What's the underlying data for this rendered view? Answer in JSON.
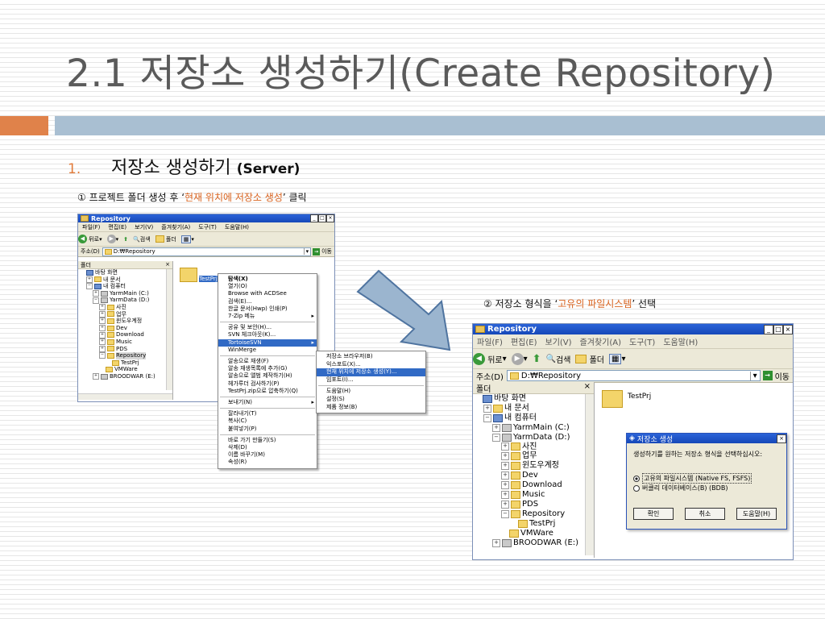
{
  "slide": {
    "title": "2.1 저장소 생성하기(Create Repository)",
    "bullet_number": "1.",
    "bullet_text": "저장소 생성하기",
    "bullet_sub": "(Server)",
    "step1_prefix": "① 프로젝트 폴더 생성 후 ‘",
    "step1_highlight": "현재 위치에 저장소 생성",
    "step1_suffix": "’ 클릭",
    "step2_prefix": "② 저장소 형식을 ‘",
    "step2_highlight": "고유의 파일시스템",
    "step2_suffix": "’ 선택",
    "colors": {
      "accent_orange": "#e0824a",
      "band_blue": "#a9bfd2",
      "title_gray": "#5a5a5a",
      "highlight": "#d9631f",
      "xp_title": "#2b63d8"
    }
  },
  "shot1": {
    "window_title": "Repository",
    "menu": [
      "파일(F)",
      "편집(E)",
      "보기(V)",
      "즐겨찾기(A)",
      "도구(T)",
      "도움말(H)"
    ],
    "toolbar": {
      "back": "뒤로",
      "search": "검색",
      "folders": "폴더"
    },
    "address_label": "주소(D)",
    "address_value": "D:₩Repository",
    "go": "이동",
    "folders_header": "폴더",
    "close_glyph": "×",
    "tree": [
      "바탕 화면",
      "내 문서",
      "내 컴퓨터",
      "YarmMain (C:)",
      "YarmData (D:)",
      "사진",
      "업무",
      "윈도우계정",
      "Dev",
      "Download",
      "Music",
      "PDS",
      "Repository",
      "TestPrj",
      "VMWare",
      "BROODWAR (E:)"
    ],
    "item_label": "TestPrj",
    "context_menu": [
      "탐색(X)",
      "열기(O)",
      "Browse with ACDSee",
      "검색(E)...",
      "한글 문서(Hwp) 인쇄(P)",
      "7-Zip 메뉴",
      "공유 및 보안(H)...",
      "SVN 체크아웃(K)...",
      "TortoiseSVN",
      "WinMerge",
      "알송으로 재생(F)",
      "알송 재생목록에 추가(G)",
      "알송으로 앨범 제작하기(H)",
      "헤가루더 검사하기(P)",
      "TestPrj.zip으로 압축하기(Q)",
      "보내기(N)",
      "잘라내기(T)",
      "복사(C)",
      "붙여넣기(P)",
      "바로 가기 만들기(S)",
      "삭제(D)",
      "이름 바꾸기(M)",
      "속성(R)"
    ],
    "submenu": [
      "저장소 브라우저(B)",
      "익스포트(X)...",
      "현재 위치에 저장소 생성(Y)...",
      "임포트(I)...",
      "도움말(H)",
      "설정(S)",
      "제품 정보(B)"
    ]
  },
  "shot2": {
    "window_title": "Repository",
    "menu": [
      "파일(F)",
      "편집(E)",
      "보기(V)",
      "즐겨찾기(A)",
      "도구(T)",
      "도움말(H)"
    ],
    "toolbar": {
      "back": "뒤로",
      "search": "검색",
      "folders": "폴더"
    },
    "address_label": "주소(D)",
    "address_value": "D:₩Repository",
    "go": "이동",
    "folders_header": "폴더",
    "close_glyph": "×",
    "tree": [
      "바탕 화면",
      "내 문서",
      "내 컴퓨터",
      "YarmMain (C:)",
      "YarmData (D:)",
      "사진",
      "업무",
      "윈도우계정",
      "Dev",
      "Download",
      "Music",
      "PDS",
      "Repository",
      "TestPrj",
      "VMWare",
      "BROODWAR (E:)"
    ],
    "item_label": "TestPrj",
    "dialog": {
      "title": "저장소 생성",
      "prompt": "생성하기를 원하는 저장소 형식을 선택하십시오:",
      "options": [
        "고유의 파일시스템 (Native FS, FSFS)",
        "버클리 데이터베이스(B) (BDB)"
      ],
      "selected_option": 0,
      "buttons": [
        "확인",
        "취소",
        "도움말(H)"
      ]
    }
  }
}
